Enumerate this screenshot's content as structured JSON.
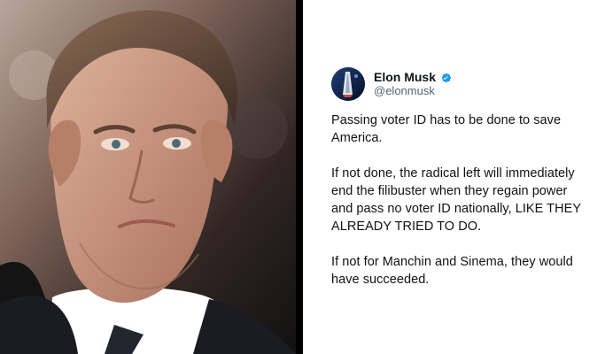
{
  "tweet": {
    "display_name": "Elon Musk",
    "handle": "@elonmusk",
    "paragraphs": [
      "Passing voter ID has to be done to save America.",
      "If not done, the radical left will immediately end the filibuster when they regain power and pass no voter ID nationally, LIKE THEY ALREADY TRIED TO DO.",
      "If not for Manchin and Sinema, they would have succeeded."
    ],
    "verified_icon": "verified-badge-icon",
    "verified_color": "#1d9bf0"
  },
  "photo": {
    "subject": "portrait-photo"
  }
}
